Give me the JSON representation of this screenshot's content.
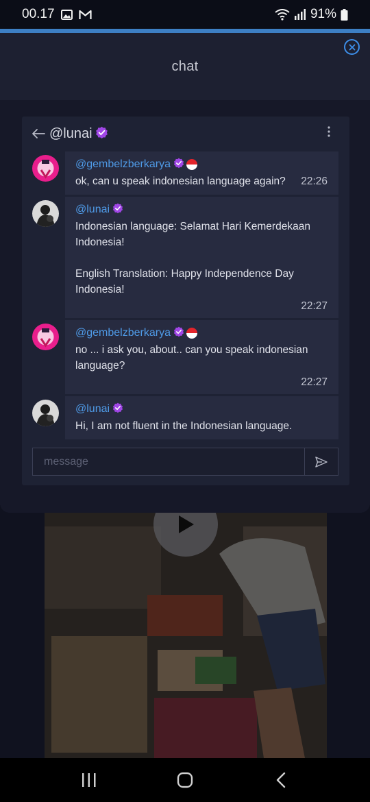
{
  "status_bar": {
    "time": "00.17",
    "battery": "91%",
    "left_icons": [
      "image-icon",
      "gmail-icon"
    ],
    "right_icons": [
      "wifi-icon",
      "signal-icon",
      "battery-icon"
    ]
  },
  "sheet": {
    "title": "chat"
  },
  "chat": {
    "username": "@lunai",
    "messages": [
      {
        "user": "@gembelzberkarya",
        "verified": true,
        "flag": "indonesia",
        "text": "ok, can u speak indonesian language again?",
        "time": "22:26"
      },
      {
        "user": "@lunai",
        "verified": true,
        "text": "Indonesian language: Selamat Hari Kemerdekaan\nIndonesia!\n\nEnglish Translation: Happy Independence Day\nIndonesia!",
        "time": "22:27"
      },
      {
        "user": "@gembelzberkarya",
        "verified": true,
        "flag": "indonesia",
        "text": "no ... i ask you, about.. can you speak indonesian\nlanguage?",
        "time": "22:27"
      },
      {
        "user": "@lunai",
        "verified": true,
        "text": "Hi, I am not fluent in the Indonesian language.",
        "time": ""
      }
    ],
    "composer_placeholder": "message"
  },
  "colors": {
    "accent": "#3d7fc4",
    "username_link": "#4f9be8",
    "verified_badge": "#a046e6",
    "panel_bg": "#1e2234",
    "bubble_bg": "#272b40"
  }
}
